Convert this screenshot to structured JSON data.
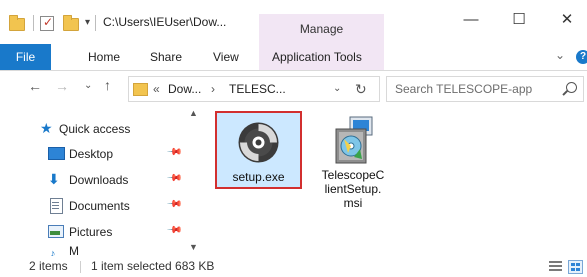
{
  "window": {
    "title_path": "C:\\Users\\IEUser\\Dow...",
    "context_tab": "Manage",
    "controls": {
      "minimize": "—",
      "maximize": "☐",
      "close": "✕"
    }
  },
  "ribbon": {
    "tabs": [
      "File",
      "Home",
      "Share",
      "View",
      "Application Tools"
    ],
    "collapse_glyph": "⌄",
    "help_glyph": "?"
  },
  "address": {
    "breadcrumb_prefix": "«",
    "segments": [
      "Dow...",
      "TELESC..."
    ],
    "separator": "›",
    "search_placeholder": "Search TELESCOPE-app"
  },
  "nav_pane": {
    "items": [
      {
        "label": "Quick access",
        "icon": "star-icon"
      },
      {
        "label": "Desktop",
        "icon": "desktop-icon"
      },
      {
        "label": "Downloads",
        "icon": "download-icon"
      },
      {
        "label": "Documents",
        "icon": "documents-icon"
      },
      {
        "label": "Pictures",
        "icon": "pictures-icon"
      },
      {
        "label": "Music",
        "icon": "music-icon"
      }
    ],
    "partial_item_label": "M"
  },
  "files": [
    {
      "name": "setup.exe",
      "icon": "disc-setup-icon",
      "selected": true
    },
    {
      "name_lines": [
        "TelescopeC",
        "lientSetup.",
        "msi"
      ],
      "icon": "msi-installer-icon",
      "selected": false
    }
  ],
  "status": {
    "item_count": "2 items",
    "selection": "1 item selected  683 KB"
  },
  "colors": {
    "accent": "#1979ca",
    "manage_tab": "#f2e6f4",
    "selection_bg": "#cce8ff",
    "highlight_border": "#d22f2f"
  }
}
